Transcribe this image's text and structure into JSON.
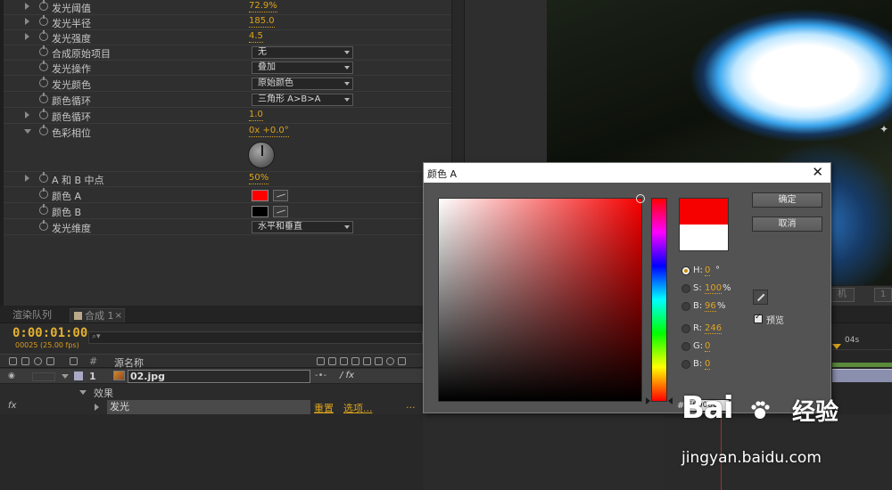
{
  "effect_controls": {
    "properties": [
      {
        "label": "发光阈值",
        "value": "72.9%"
      },
      {
        "label": "发光半径",
        "value": "185.0"
      },
      {
        "label": "发光强度",
        "value": "4.5"
      },
      {
        "label": "合成原始项目",
        "value": "无"
      },
      {
        "label": "发光操作",
        "value": "叠加"
      },
      {
        "label": "发光颜色",
        "value": "原始颜色"
      },
      {
        "label": "颜色循环",
        "value": "三角形 A>B>A"
      },
      {
        "label": "颜色循环",
        "value": "1.0"
      },
      {
        "label": "色彩相位",
        "value": "0x +0.0°"
      },
      {
        "label": "A 和 B 中点",
        "value": "50%"
      },
      {
        "label": "颜色 A",
        "value": "#ff0000"
      },
      {
        "label": "颜色 B",
        "value": "#000000"
      },
      {
        "label": "发光维度",
        "value": "水平和垂直"
      }
    ]
  },
  "viewer": {
    "camera_label": "机",
    "camera_count": "1"
  },
  "timeline": {
    "tabs": [
      "渲染队列",
      "合成 1"
    ],
    "timecode": "0:00:01:00",
    "frames": "00025 (25.00 fps)",
    "column_number": "#",
    "column_source": "源名称",
    "layer": {
      "number": "1",
      "name": "02.jpg"
    },
    "effects_label": "效果",
    "glow_effect": {
      "name": "发光",
      "reset": "重置",
      "options": "选项...",
      "more": "..."
    },
    "ruler_label": "04s"
  },
  "color_dialog": {
    "title": "颜色 A",
    "close": "✕",
    "ok": "确定",
    "cancel": "取消",
    "hsb": {
      "h": "0",
      "h_unit": "°",
      "s": "100",
      "s_unit": "%",
      "b": "96",
      "b_unit": "%"
    },
    "rgb": {
      "r": "246",
      "g": "0",
      "b": "0"
    },
    "hex": "F60000",
    "preview_label": "预览",
    "new_color": "#f60000",
    "old_color": "#ffffff",
    "selected_mode": "H"
  },
  "watermark": {
    "logo": "Bai",
    "logo_suffix": "经验",
    "url": "jingyan.baidu.com"
  }
}
